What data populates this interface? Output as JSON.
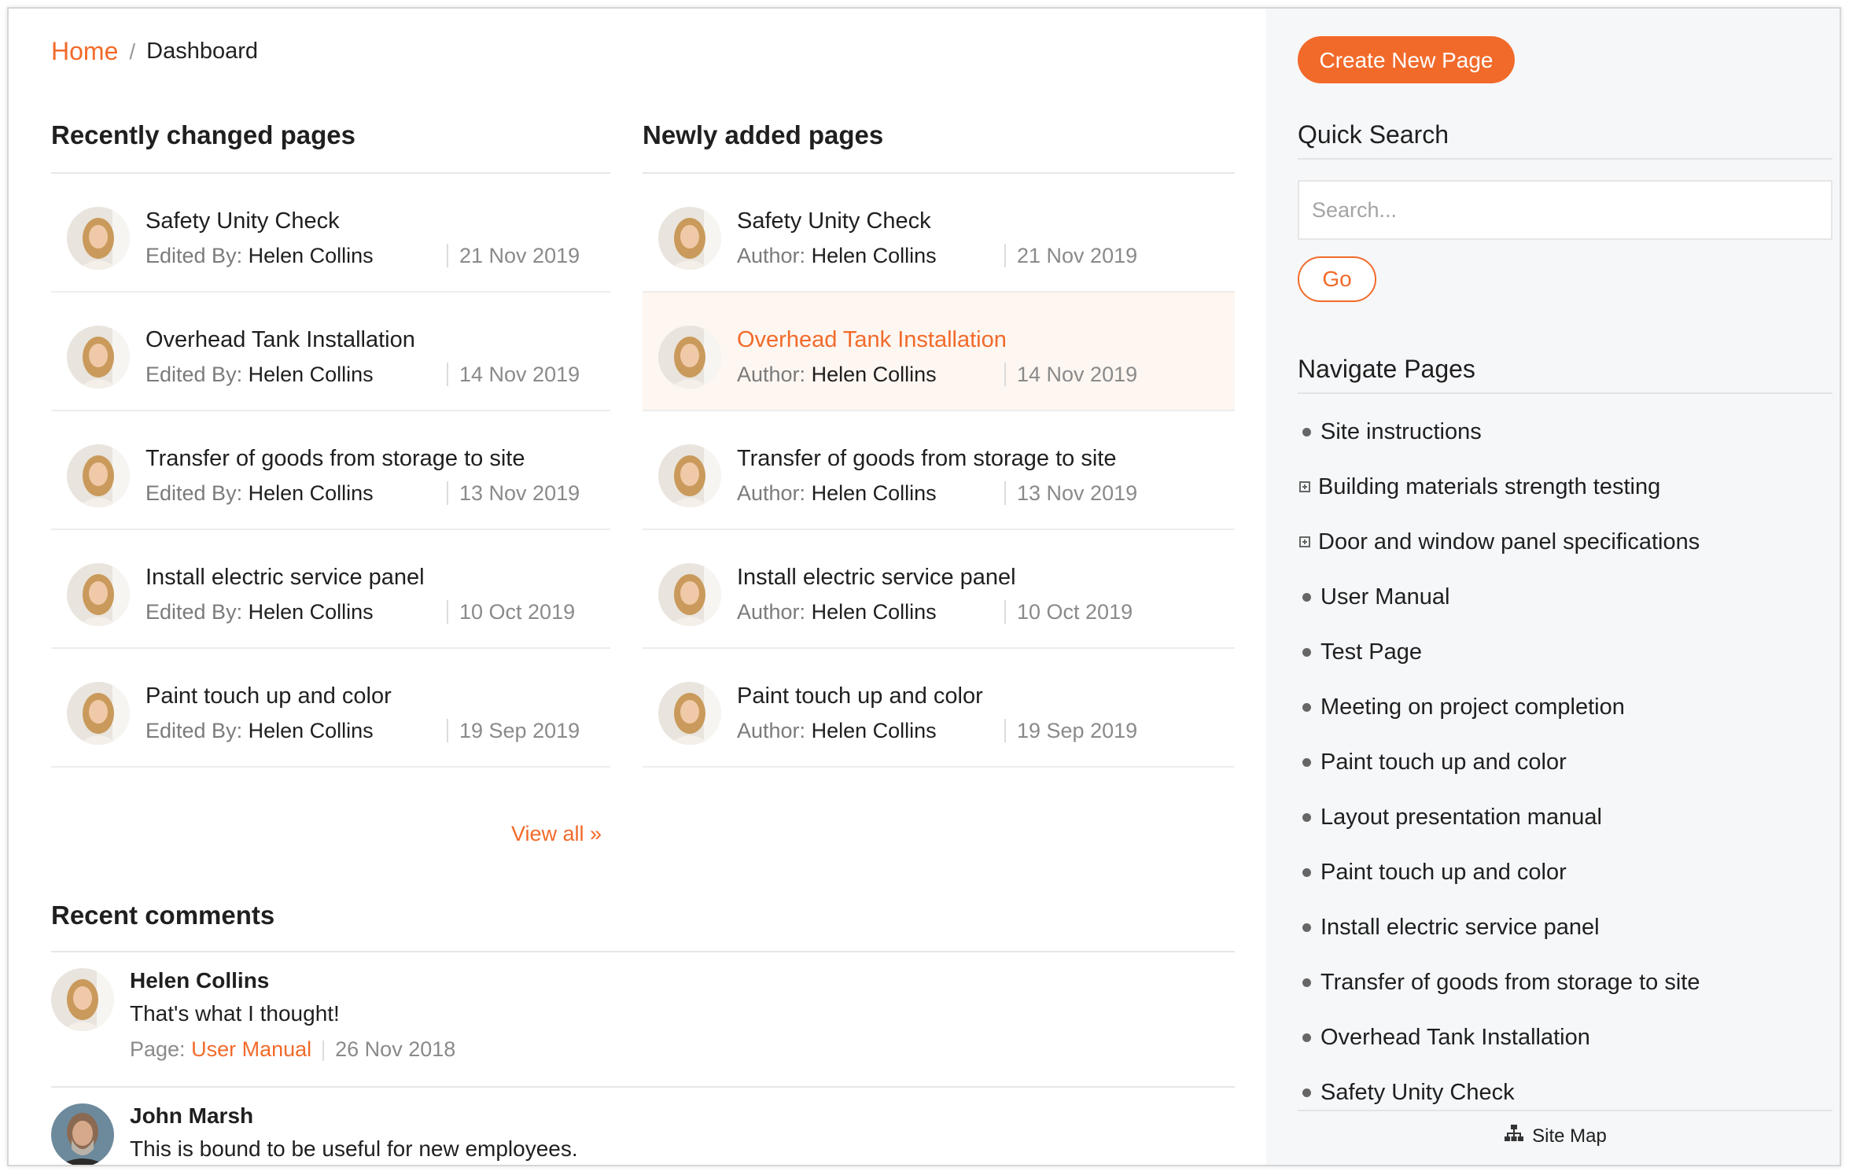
{
  "breadcrumb": {
    "home": "Home",
    "separator": "/",
    "current": "Dashboard"
  },
  "recently_changed": {
    "title": "Recently changed pages",
    "meta_label": "Edited By:",
    "items": [
      {
        "title": "Safety Unity Check",
        "author": "Helen Collins",
        "date": "21 Nov 2019"
      },
      {
        "title": "Overhead Tank Installation",
        "author": "Helen Collins",
        "date": "14 Nov 2019"
      },
      {
        "title": "Transfer of goods from storage to site",
        "author": "Helen Collins",
        "date": "13 Nov 2019"
      },
      {
        "title": "Install electric service panel",
        "author": "Helen Collins",
        "date": "10 Oct 2019"
      },
      {
        "title": "Paint touch up and color",
        "author": "Helen Collins",
        "date": "19 Sep 2019"
      }
    ]
  },
  "newly_added": {
    "title": "Newly added pages",
    "meta_label": "Author:",
    "items": [
      {
        "title": "Safety Unity Check",
        "author": "Helen Collins",
        "date": "21 Nov 2019"
      },
      {
        "title": "Overhead Tank Installation",
        "author": "Helen Collins",
        "date": "14 Nov 2019"
      },
      {
        "title": "Transfer of goods from storage to site",
        "author": "Helen Collins",
        "date": "13 Nov 2019"
      },
      {
        "title": "Install electric service panel",
        "author": "Helen Collins",
        "date": "10 Oct 2019"
      },
      {
        "title": "Paint touch up and color",
        "author": "Helen Collins",
        "date": "19 Sep 2019"
      }
    ]
  },
  "view_all": "View all »",
  "recent_comments": {
    "title": "Recent comments",
    "items": [
      {
        "name": "Helen Collins",
        "text": "That's what I thought!",
        "page_label": "Page:",
        "page": "User Manual",
        "date": "26 Nov 2018"
      },
      {
        "name": "John Marsh",
        "text": "This is bound to be useful for new employees."
      }
    ]
  },
  "sidebar": {
    "create_button": "Create New Page",
    "quick_search_title": "Quick Search",
    "search_placeholder": "Search...",
    "go_button": "Go",
    "navigate_title": "Navigate Pages",
    "nav_items": [
      {
        "label": "Site instructions",
        "icon": "bullet-icon"
      },
      {
        "label": "Building materials strength testing",
        "icon": "expand-icon"
      },
      {
        "label": "Door and window panel specifications",
        "icon": "expand-icon"
      },
      {
        "label": "User Manual",
        "icon": "bullet-icon"
      },
      {
        "label": "Test Page",
        "icon": "bullet-icon"
      },
      {
        "label": "Meeting on project completion",
        "icon": "bullet-icon"
      },
      {
        "label": "Paint touch up and color",
        "icon": "bullet-icon"
      },
      {
        "label": "Layout presentation manual",
        "icon": "bullet-icon"
      },
      {
        "label": "Paint touch up and color",
        "icon": "bullet-icon"
      },
      {
        "label": "Install electric service panel",
        "icon": "bullet-icon"
      },
      {
        "label": "Transfer of goods from storage to site",
        "icon": "bullet-icon"
      },
      {
        "label": "Overhead Tank Installation",
        "icon": "bullet-icon"
      },
      {
        "label": "Safety Unity Check",
        "icon": "bullet-icon"
      }
    ],
    "sitemap": "Site Map"
  },
  "colors": {
    "accent": "#f26a2a",
    "sidebar_bg": "#f6f7f9",
    "highlight_row": "#fdf6f1"
  }
}
